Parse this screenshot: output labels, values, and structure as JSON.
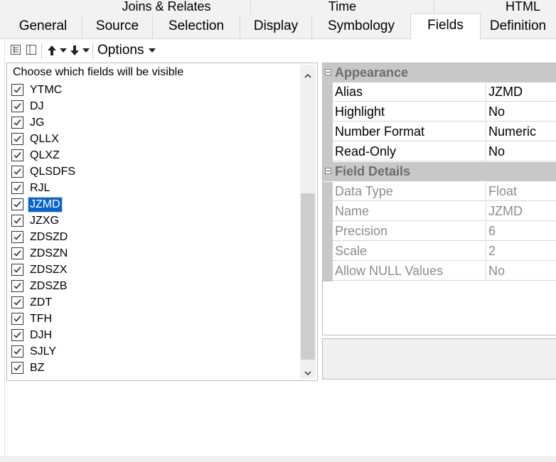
{
  "tabs_row1": [
    {
      "label": "Joins & Relates"
    },
    {
      "label": "Time"
    },
    {
      "label": "HTML"
    }
  ],
  "tabs_row2": [
    {
      "label": "General"
    },
    {
      "label": "Source"
    },
    {
      "label": "Selection"
    },
    {
      "label": "Display"
    },
    {
      "label": "Symbology"
    },
    {
      "label": "Fields",
      "active": true
    },
    {
      "label": "Definition"
    }
  ],
  "toolbar": {
    "list_view_icon": "list-view-icon",
    "table_view_icon": "table-view-icon",
    "move_up_icon": "move-up-arrow-icon",
    "move_down_icon": "move-down-arrow-icon",
    "options_label": "Options"
  },
  "field_list": {
    "header": "Choose which fields will be visible",
    "selected": "JZMD",
    "fields": [
      {
        "name": "YTMC",
        "checked": true
      },
      {
        "name": "DJ",
        "checked": true
      },
      {
        "name": "JG",
        "checked": true
      },
      {
        "name": "QLLX",
        "checked": true
      },
      {
        "name": "QLXZ",
        "checked": true
      },
      {
        "name": "QLSDFS",
        "checked": true
      },
      {
        "name": "RJL",
        "checked": true
      },
      {
        "name": "JZMD",
        "checked": true
      },
      {
        "name": "JZXG",
        "checked": true
      },
      {
        "name": "ZDSZD",
        "checked": true
      },
      {
        "name": "ZDSZN",
        "checked": true
      },
      {
        "name": "ZDSZX",
        "checked": true
      },
      {
        "name": "ZDSZB",
        "checked": true
      },
      {
        "name": "ZDT",
        "checked": true
      },
      {
        "name": "TFH",
        "checked": true
      },
      {
        "name": "DJH",
        "checked": true
      },
      {
        "name": "SJLY",
        "checked": true
      },
      {
        "name": "BZ",
        "checked": true
      }
    ]
  },
  "properties": {
    "appearance": {
      "title": "Appearance",
      "rows": [
        {
          "name": "Alias",
          "value": "JZMD"
        },
        {
          "name": "Highlight",
          "value": "No"
        },
        {
          "name": "Number Format",
          "value": "Numeric"
        },
        {
          "name": "Read-Only",
          "value": "No"
        }
      ]
    },
    "field_details": {
      "title": "Field Details",
      "rows": [
        {
          "name": "Data Type",
          "value": "Float"
        },
        {
          "name": "Name",
          "value": "JZMD"
        },
        {
          "name": "Precision",
          "value": "6"
        },
        {
          "name": "Scale",
          "value": "2"
        },
        {
          "name": "Allow NULL Values",
          "value": "No"
        }
      ]
    }
  },
  "colors": {
    "selection": "#0a64c8",
    "category_bg": "#c8c8c8",
    "readonly_text": "#8c8c8c"
  }
}
